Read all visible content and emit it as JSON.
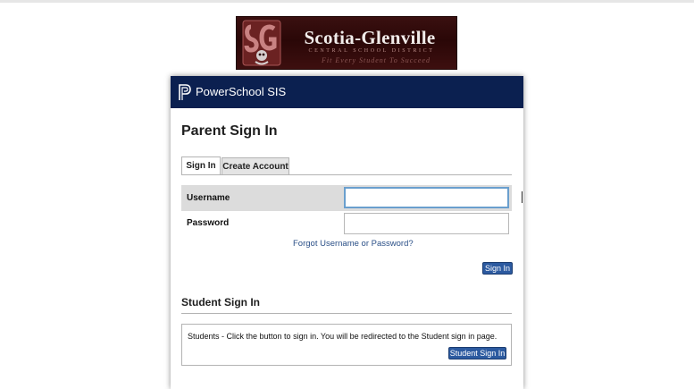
{
  "logo": {
    "name": "Scotia-Glenville",
    "subtitle": "Central School District",
    "tagline": "Fit Every Student To Succeed",
    "seal_letters": "SG",
    "colors": {
      "background": "#2a0707",
      "seal": "#8e3a3a"
    }
  },
  "header": {
    "brand": "PowerSchool SIS",
    "icon": "powerschool-logo-icon",
    "color": "#0b2050"
  },
  "parent_signin": {
    "title": "Parent Sign In",
    "tabs": [
      {
        "label": "Sign In",
        "active": true
      },
      {
        "label": "Create Account",
        "active": false
      }
    ],
    "username_label": "Username",
    "username_value": "",
    "password_label": "Password",
    "password_value": "",
    "forgot_link": "Forgot Username or Password?",
    "signin_button": "Sign In"
  },
  "student_signin": {
    "title": "Student Sign In",
    "message": "Students - Click the button to sign in. You will be redirected to the Student sign in page.",
    "button": "Student Sign In"
  },
  "colors": {
    "button": "#2c5aa0",
    "link": "#2a4f87",
    "focus_border": "#6a9fce"
  }
}
